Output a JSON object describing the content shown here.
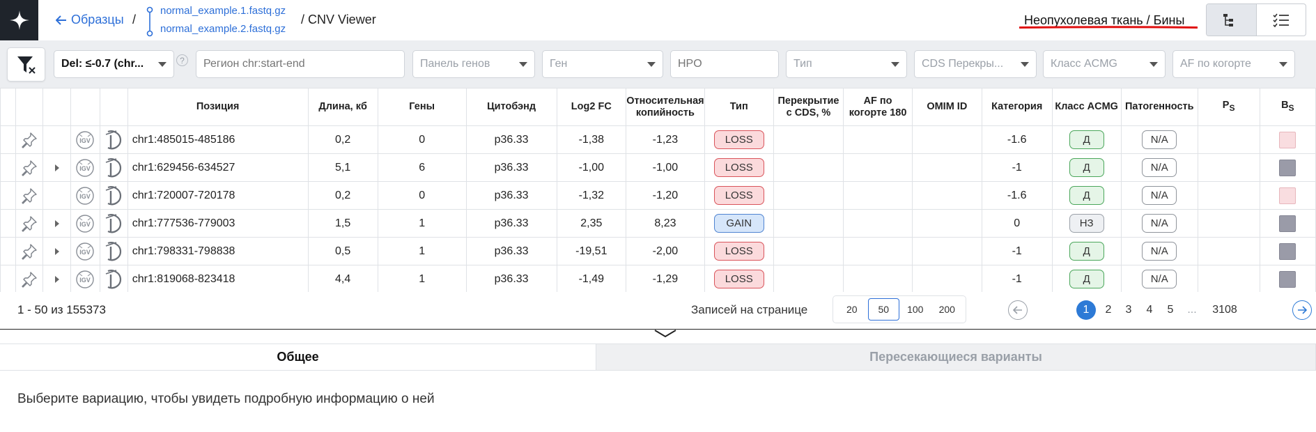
{
  "header": {
    "back_label": "Образцы",
    "separator": "/",
    "file1": "normal_example.1.fastq.gz",
    "file2": "normal_example.2.fastq.gz",
    "tail": "/ CNV Viewer",
    "view_label": "Неопухолевая ткань / Бины",
    "underline_color": "#e01010"
  },
  "filters": {
    "del_filter": "Del: ≤-0.7 (chr...",
    "help_mark": "?",
    "region_placeholder": "Регион chr:start-end",
    "gene_panel": "Панель генов",
    "gene": "Ген",
    "hpo_placeholder": "HPO",
    "type": "Тип",
    "cds": "CDS Перекры...",
    "acmg": "Класс ACMG",
    "af": "AF по когорте"
  },
  "columns": {
    "position": "Позиция",
    "length": "Длина, кб",
    "genes": "Гены",
    "cytoband": "Цитобэнд",
    "log2fc": "Log2 FC",
    "relcopy": "Относительная копийность",
    "type": "Тип",
    "cds": "Перекрытие с CDS, %",
    "af": "AF по когорте 180",
    "omim": "OMIM ID",
    "category": "Категория",
    "acmg": "Класс ACMG",
    "pathogenicity": "Патогенность",
    "ps": "P",
    "ps_sub": "S",
    "bs": "B",
    "bs_sub": "S"
  },
  "rows": [
    {
      "position": "chr1:485015-485186",
      "length": "0,2",
      "genes": "0",
      "cytoband": "p36.33",
      "log2fc": "-1,38",
      "relcopy": "-1,23",
      "type": "LOSS",
      "category": "-1.6",
      "acmg": "Д",
      "path": "N/A",
      "bs_color": "light"
    },
    {
      "position": "chr1:629456-634527",
      "length": "5,1",
      "genes": "6",
      "cytoband": "p36.33",
      "log2fc": "-1,00",
      "relcopy": "-1,00",
      "type": "LOSS",
      "category": "-1",
      "acmg": "Д",
      "path": "N/A",
      "bs_color": "grey"
    },
    {
      "position": "chr1:720007-720178",
      "length": "0,2",
      "genes": "0",
      "cytoband": "p36.33",
      "log2fc": "-1,32",
      "relcopy": "-1,20",
      "type": "LOSS",
      "category": "-1.6",
      "acmg": "Д",
      "path": "N/A",
      "bs_color": "light"
    },
    {
      "position": "chr1:777536-779003",
      "length": "1,5",
      "genes": "1",
      "cytoband": "p36.33",
      "log2fc": "2,35",
      "relcopy": "8,23",
      "type": "GAIN",
      "category": "0",
      "acmg": "НЗ",
      "path": "N/A",
      "bs_color": "grey"
    },
    {
      "position": "chr1:798331-798838",
      "length": "0,5",
      "genes": "1",
      "cytoband": "p36.33",
      "log2fc": "-19,51",
      "relcopy": "-2,00",
      "type": "LOSS",
      "category": "-1",
      "acmg": "Д",
      "path": "N/A",
      "bs_color": "grey"
    },
    {
      "position": "chr1:819068-823418",
      "length": "4,4",
      "genes": "1",
      "cytoband": "p36.33",
      "log2fc": "-1,49",
      "relcopy": "-1,29",
      "type": "LOSS",
      "category": "-1",
      "acmg": "Д",
      "path": "N/A",
      "bs_color": "grey"
    }
  ],
  "pagination": {
    "range": "1 - 50 из 155373",
    "per_page_label": "Записей на странице",
    "per_page_options": [
      "20",
      "50",
      "100",
      "200"
    ],
    "per_page_selected": "50",
    "pages": [
      "1",
      "2",
      "3",
      "4",
      "5",
      "...",
      "3108"
    ],
    "current_page": "1"
  },
  "tabs": {
    "general": "Общее",
    "overlapping": "Пересекающиеся варианты"
  },
  "details": {
    "empty_message": "Выберите вариацию, чтобы увидеть подробную информацию о ней"
  }
}
